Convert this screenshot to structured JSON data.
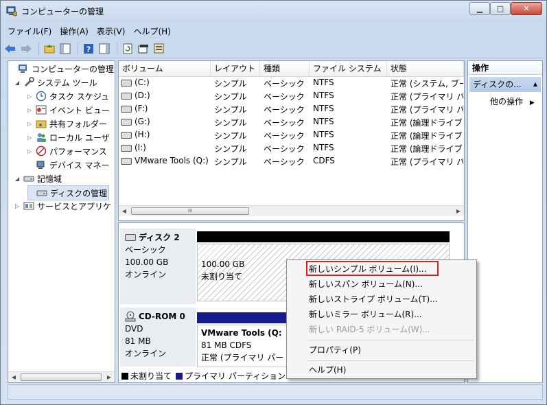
{
  "window": {
    "title": "コンピューターの管理",
    "caption": {
      "minimize": "▁",
      "maximize": "□",
      "close": "✕"
    }
  },
  "menu": [
    "ファイル(F)",
    "操作(A)",
    "表示(V)",
    "ヘルプ(H)"
  ],
  "toolbar": {
    "icons": [
      "back-arrow-icon",
      "forward-arrow-icon",
      "up-folder-icon",
      "show-tree-icon",
      "help-icon",
      "properties-pane-icon",
      "refresh-icon",
      "properties-icon",
      "export-icon"
    ]
  },
  "tree": {
    "items": [
      {
        "label": "コンピューターの管理 (",
        "level": 0,
        "expander": "",
        "icon": "computer-icon"
      },
      {
        "label": "システム ツール",
        "level": 1,
        "expander": "◢",
        "icon": "tools-icon"
      },
      {
        "label": "タスク スケジュ",
        "level": 2,
        "expander": "▷",
        "icon": "clock-icon"
      },
      {
        "label": "イベント ビュー",
        "level": 2,
        "expander": "▷",
        "icon": "event-viewer-icon"
      },
      {
        "label": "共有フォルダー",
        "level": 2,
        "expander": "▷",
        "icon": "shared-folder-icon"
      },
      {
        "label": "ローカル ユーザ",
        "level": 2,
        "expander": "▷",
        "icon": "users-icon"
      },
      {
        "label": "パフォーマンス",
        "level": 2,
        "expander": "▷",
        "icon": "performance-icon"
      },
      {
        "label": "デバイス マネー",
        "level": 2,
        "expander": "",
        "icon": "device-manager-icon"
      },
      {
        "label": "記憶域",
        "level": 1,
        "expander": "◢",
        "icon": "storage-icon"
      },
      {
        "label": "ディスクの管理",
        "level": 2,
        "expander": "",
        "icon": "disk-management-icon",
        "selected": true
      },
      {
        "label": "サービスとアプリケ",
        "level": 1,
        "expander": "▷",
        "icon": "services-icon"
      }
    ]
  },
  "volumes": {
    "columns": [
      "ボリューム",
      "レイアウト",
      "種類",
      "ファイル システム",
      "状態"
    ],
    "rows": [
      [
        "(C:)",
        "シンプル",
        "ベーシック",
        "NTFS",
        "正常 (システム, ブー"
      ],
      [
        "(D:)",
        "シンプル",
        "ベーシック",
        "NTFS",
        "正常 (プライマリ パ"
      ],
      [
        "(F:)",
        "シンプル",
        "ベーシック",
        "NTFS",
        "正常 (プライマリ パ"
      ],
      [
        "(G:)",
        "シンプル",
        "ベーシック",
        "NTFS",
        "正常 (論理ドライブ"
      ],
      [
        "(H:)",
        "シンプル",
        "ベーシック",
        "NTFS",
        "正常 (論理ドライブ"
      ],
      [
        "(I:)",
        "シンプル",
        "ベーシック",
        "NTFS",
        "正常 (論理ドライブ"
      ],
      [
        "VMware Tools (Q:)",
        "シンプル",
        "ベーシック",
        "CDFS",
        "正常 (プライマリ パ"
      ]
    ],
    "scroll_grip": "III"
  },
  "disks": [
    {
      "name": "ディスク 2",
      "type": "ベーシック",
      "size": "100.00 GB",
      "status": "オンライン",
      "partition": {
        "size": "100.00 GB",
        "label": "未割り当て"
      }
    },
    {
      "name": "CD-ROM 0",
      "type": "DVD",
      "size": "81 MB",
      "status": "オンライン",
      "partition": {
        "name": "VMware Tools (Q:",
        "detail": "81 MB CDFS",
        "status": "正常 (プライマリ パー"
      }
    }
  ],
  "legend": [
    {
      "label": "未割り当て",
      "color": "#000000"
    },
    {
      "label": "プライマリ パーティション",
      "color": "#1a1a8c"
    }
  ],
  "operations": {
    "header": "操作",
    "selected": "ディスクの...",
    "more": "他の操作"
  },
  "context_menu": {
    "items": [
      {
        "label": "新しいシンプル ボリューム(I)...",
        "enabled": true,
        "highlighted": true
      },
      {
        "label": "新しいスパン ボリューム(N)...",
        "enabled": true
      },
      {
        "label": "新しいストライプ ボリューム(T)...",
        "enabled": true
      },
      {
        "label": "新しいミラー ボリューム(R)...",
        "enabled": true
      },
      {
        "label": "新しい RAID-5 ボリューム(W)...",
        "enabled": false
      },
      {
        "label": "プロパティ(P)",
        "enabled": true
      },
      {
        "label": "ヘルプ(H)",
        "enabled": true
      }
    ]
  },
  "colors": {
    "unallocated": "#000000",
    "primary": "#1a1a8c",
    "highlight_box": "#e02020"
  }
}
